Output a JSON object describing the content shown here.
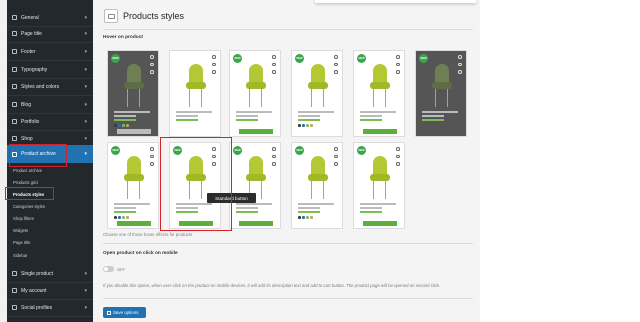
{
  "sidebar": {
    "items": [
      {
        "label": "General",
        "kind": "main"
      },
      {
        "label": "Page title",
        "kind": "main"
      },
      {
        "label": "Footer",
        "kind": "main"
      },
      {
        "label": "Typography",
        "kind": "main"
      },
      {
        "label": "Styles and colors",
        "kind": "main"
      },
      {
        "label": "Blog",
        "kind": "main"
      },
      {
        "label": "Portfolio",
        "kind": "main"
      },
      {
        "label": "Shop",
        "kind": "main"
      },
      {
        "label": "Product archive",
        "kind": "main",
        "active": true
      },
      {
        "label": "Product archive",
        "kind": "sub"
      },
      {
        "label": "Products grid",
        "kind": "sub"
      },
      {
        "label": "Products styles",
        "kind": "sub",
        "current": true
      },
      {
        "label": "Categories styles",
        "kind": "sub"
      },
      {
        "label": "Shop filters",
        "kind": "sub"
      },
      {
        "label": "Widgets",
        "kind": "sub"
      },
      {
        "label": "Page title",
        "kind": "sub"
      },
      {
        "label": "Sidebar",
        "kind": "sub"
      },
      {
        "label": "Single product",
        "kind": "main"
      },
      {
        "label": "My account",
        "kind": "main"
      },
      {
        "label": "Social profiles",
        "kind": "main"
      }
    ]
  },
  "header": {
    "title": "Products styles",
    "icon": "archive-icon"
  },
  "hover_section": {
    "title": "Hover on product",
    "hint": "Choose one of those hover effects for products",
    "tooltip": "Standard button",
    "new_badge": "NEW",
    "selected_index": 7
  },
  "mobile_section": {
    "title": "Open product on click on mobile",
    "toggle_label": "OFF",
    "description": "If you disable this option, when user click on the product on mobile devices, it will add its description text and add to cart button. The product page will be opened on second click."
  },
  "save_button": {
    "label": "Save options"
  },
  "colors": {
    "accent": "#2271b1",
    "sidebar_bg": "#23282d",
    "badge_green": "#3aa54b",
    "button_green": "#5bb03a",
    "highlight_red": "#d6202b"
  }
}
